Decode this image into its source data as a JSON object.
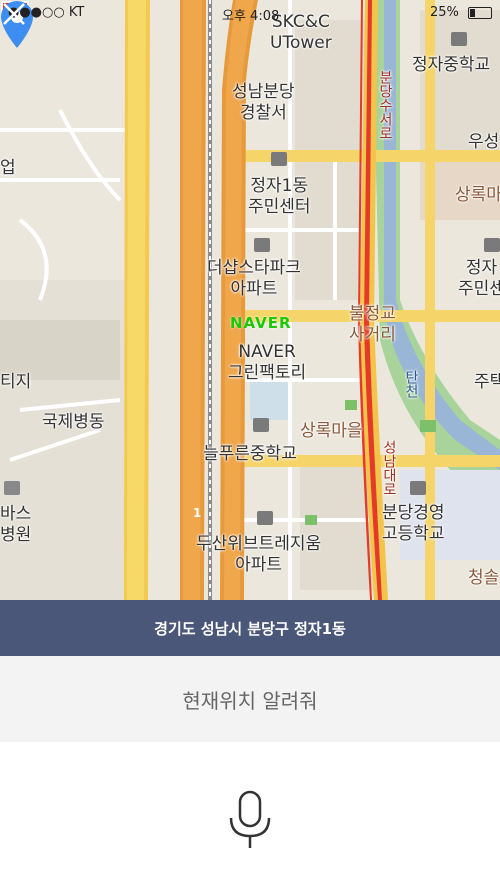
{
  "status_bar": {
    "carrier": "●●●○○ KT",
    "time": "오후 4:08",
    "battery": "25%"
  },
  "map": {
    "labels": {
      "skcc": "SKC&C\nUTower",
      "police": "성남분당\n경찰서",
      "community": "정자1동\n주민센터",
      "thesharp": "더샵스타파크\n아파트",
      "naver_green": "NAVER\n그린팩토리",
      "intersection": "불정교\n사거리",
      "sangnok": "상록마을",
      "middle_school": "늘푸른중학교",
      "dusan": "두산위브트레지움\n아파트",
      "high_school": "분당경영\n고등학교",
      "jeongja_middle": "정자중학교",
      "jeongja_right": "정자\n주민센",
      "sangnok_right": "상록마",
      "woosung": "우성",
      "hospital": "국제병동",
      "tiji": "티지",
      "bus_hospital": "바스\n병원",
      "joo": "주택",
      "eop": "업",
      "cheongsol": "청솔",
      "tancheon": "탄천",
      "road_red": "분당수서로",
      "road_red2": "성남대로",
      "route_number": "1",
      "naver_logo": "NAVER"
    }
  },
  "address": "경기도 성남시 분당구 정자1동",
  "query": "현재위치 알려줘",
  "colors": {
    "address_bar": "#4a5778",
    "query_bar": "#f3f3f3",
    "pin": "#3d8ef0",
    "naver_green": "#1ec800"
  },
  "icons": {
    "close": "close-icon",
    "mic": "microphone-icon",
    "pin": "location-pin-icon"
  }
}
